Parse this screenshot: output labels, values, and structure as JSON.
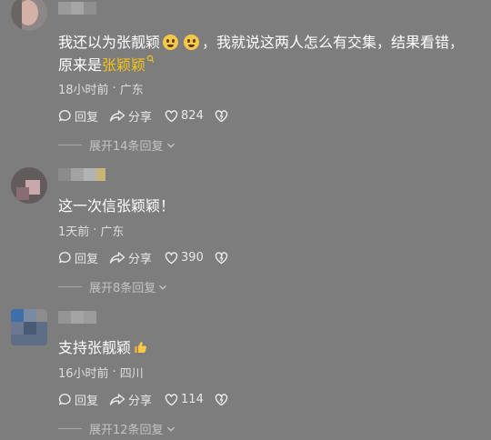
{
  "comments": [
    {
      "text_before": "我还以为张靓颖",
      "text_after": "，我就说这两人怎么有交集，结果看错，原来是",
      "highlight": "张颖颖",
      "time": "18小时前",
      "location": "广东",
      "reply_label": "回复",
      "share_label": "分享",
      "likes": "824",
      "expand_label": "展开14条回复"
    },
    {
      "text": "这一次信张颖颖！",
      "time": "1天前",
      "location": "广东",
      "reply_label": "回复",
      "share_label": "分享",
      "likes": "390",
      "expand_label": "展开8条回复"
    },
    {
      "text": "支持张靓颖",
      "time": "16小时前",
      "location": "四川",
      "reply_label": "回复",
      "share_label": "分享",
      "likes": "114",
      "expand_label": "展开12条回复"
    }
  ],
  "meta_separator": "·",
  "colors": {
    "background": "#7d7d7d",
    "highlight": "#f3c21a",
    "text": "#ffffff"
  },
  "icons": [
    "grin-emoji-icon",
    "search-tag-icon",
    "reply-icon",
    "share-icon",
    "like-icon",
    "dislike-icon",
    "chevron-down-icon",
    "thumbs-up-emoji-icon"
  ]
}
